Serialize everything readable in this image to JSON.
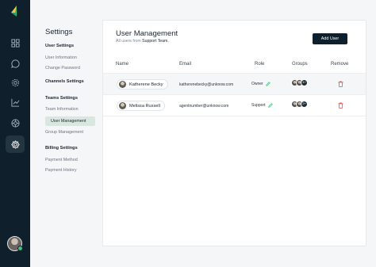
{
  "nav": {
    "items": [
      {
        "name": "dashboard",
        "icon": "grid-icon"
      },
      {
        "name": "messages",
        "icon": "chat-icon"
      },
      {
        "name": "settings-wheel",
        "icon": "gear-icon"
      },
      {
        "name": "analytics",
        "icon": "chart-icon"
      },
      {
        "name": "support",
        "icon": "lifebuoy-icon"
      },
      {
        "name": "settings",
        "icon": "settings-icon",
        "active": true
      }
    ]
  },
  "settings": {
    "title": "Settings",
    "sections": [
      {
        "label": "User Settings",
        "items": [
          "User Information",
          "Change Password"
        ]
      },
      {
        "label": "Channels Settings",
        "items": []
      },
      {
        "label": "Teams Settings",
        "items": [
          "Team Information",
          "User Management",
          "Group Management"
        ]
      },
      {
        "label": "Billing Settings",
        "items": [
          "Payment Method",
          "Payment History"
        ]
      }
    ]
  },
  "main": {
    "title": "User Management",
    "subtitle_prefix": "All users from",
    "subtitle_team": "Support Team.",
    "add_user_label": "Add User",
    "columns": [
      "Name",
      "Email",
      "Role",
      "Groups",
      "Remove"
    ],
    "rows": [
      {
        "name": "Katherene Becky",
        "email": "katherenebecky@unknow.com",
        "role": "Owner",
        "groups_more": "4+"
      },
      {
        "name": "Melissa Russell",
        "email": "agentnumber@unknow.com",
        "role": "Support",
        "groups_more": "2+"
      }
    ]
  },
  "colors": {
    "rail": "#0f1f2b",
    "accent_green": "#3fc17a",
    "active_item": "#d9e7e1",
    "danger": "#e0524c"
  }
}
